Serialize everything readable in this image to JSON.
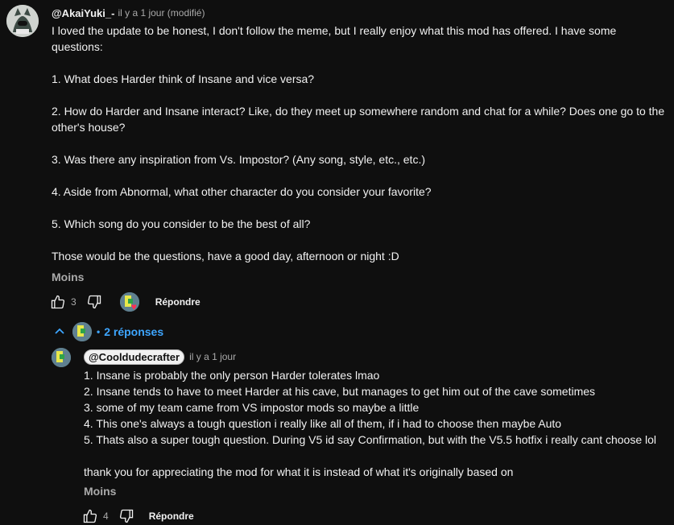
{
  "comment": {
    "author": "@AkaiYuki_-",
    "time": "il y a 1 jour (modifié)",
    "lines": [
      "I loved the update to be honest, I don't follow the meme, but I really enjoy what this mod has offered. I have some",
      "questions:",
      "",
      "1. What does Harder think of Insane and vice versa?",
      "",
      "2. How do Harder and Insane interact? Like, do they meet up somewhere random and chat for a while? Does one go to the",
      "other's house?",
      "",
      "3. Was there any inspiration from Vs. Impostor? (Any song, style, etc., etc.)",
      "",
      "4. Aside from Abnormal, what other character do you consider your favorite?",
      "",
      "5. Which song do you consider to be the best of all?",
      "",
      "Those would be the questions, have a good day, afternoon or night :D"
    ],
    "less_label": "Moins",
    "like_count": "3",
    "reply_label": "Répondre"
  },
  "replies_toggle": {
    "label": "2 réponses",
    "separator": "•"
  },
  "reply": {
    "author": "@Cooldudecrafter",
    "time": "il y a 1 jour",
    "lines": [
      "1. Insane is probably the only person Harder tolerates lmao",
      "2. Insane tends to have to meet Harder at his cave, but manages to get him out of the cave sometimes",
      "3. some of my team came from VS impostor mods so maybe a little",
      "4. This one's always a tough question i really like all of them, if i had to choose then maybe Auto",
      "5. Thats also a super tough question. During V5 id say Confirmation, but with the V5.5 hotfix i really cant choose lol",
      "",
      "thank you for appreciating the mod for what it is instead of what it's originally based on"
    ],
    "less_label": "Moins",
    "like_count": "4",
    "reply_label": "Répondre"
  },
  "icons": {
    "like": "thumbs-up-icon",
    "dislike": "thumbs-down-icon",
    "heart": "heart-icon",
    "chevron": "chevron-up-icon"
  },
  "colors": {
    "background": "#0f0f0f",
    "text": "#f1f1f1",
    "secondary": "#aaaaaa",
    "link": "#3ea6ff",
    "heart": "#ff2d55"
  }
}
